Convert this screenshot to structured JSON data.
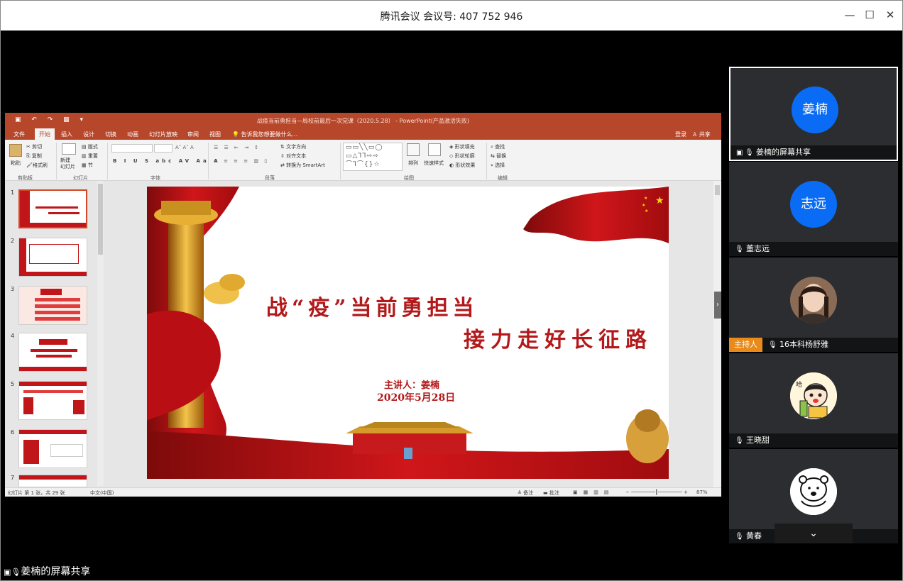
{
  "window": {
    "title": "腾讯会议 会议号: 407 752 946",
    "minimize": "—",
    "maximize": "☐",
    "close": "✕"
  },
  "ppt": {
    "doc_title": "战疫当前勇担当—局校前最后一次党课（2020.5.28） - PowerPoint(产品激活失败)",
    "tabs": [
      "文件",
      "开始",
      "插入",
      "设计",
      "切换",
      "动画",
      "幻灯片放映",
      "审阅",
      "视图"
    ],
    "tellme": "告诉我您想要做什么...",
    "login": "登录",
    "share": "共享",
    "ribbon": {
      "paste": "粘贴",
      "cut": "剪切",
      "copy": "复制",
      "format_painter": "格式刷",
      "clipboard_group": "剪贴板",
      "new_slide": "新建\n幻灯片",
      "layout": "版式",
      "reset": "重置",
      "section": "节",
      "slides_group": "幻灯片",
      "font_group": "字体",
      "text_direction": "文字方向",
      "align_text": "对齐文本",
      "smartart": "转换为 SmartArt",
      "paragraph_group": "段落",
      "arrange": "排列",
      "quick_styles": "快速样式",
      "shape_fill": "形状填充",
      "shape_outline": "形状轮廓",
      "shape_effects": "形状效果",
      "drawing_group": "绘图",
      "find": "查找",
      "replace": "替换",
      "select": "选择",
      "editing_group": "编辑"
    },
    "slide_numbers": [
      "1",
      "2",
      "3",
      "4",
      "5",
      "6",
      "7"
    ],
    "slide": {
      "line1": "战“疫”当前勇担当",
      "line2": "接力走好长征路",
      "presenter": "主讲人：姜楠",
      "date": "2020年5月28日"
    },
    "status": {
      "slide_count": "幻灯片 第 1 张，共 29 张",
      "language": "中文(中国)",
      "notes": "备注",
      "comments": "批注",
      "zoom": "87%"
    }
  },
  "participants": [
    {
      "avatar_text": "姜楠",
      "name": "姜楠的屏幕共享",
      "type": "avatar"
    },
    {
      "avatar_text": "志远",
      "name": "董志远",
      "type": "avatar"
    },
    {
      "avatar_text": "",
      "name": "16本科杨舒雅",
      "host": "主持人",
      "type": "photo"
    },
    {
      "avatar_text": "",
      "name": "王晓甜",
      "type": "cartoon"
    },
    {
      "avatar_text": "",
      "name": "黄春",
      "type": "sticker"
    }
  ],
  "bottom": {
    "share_label": "姜楠的屏幕共享",
    "expand": "⌄"
  },
  "colors": {
    "ppt_red": "#b7472a",
    "avatar_blue": "#0a6cf5",
    "host_orange": "#e88b1a",
    "tile_bg": "#2b2d30"
  }
}
